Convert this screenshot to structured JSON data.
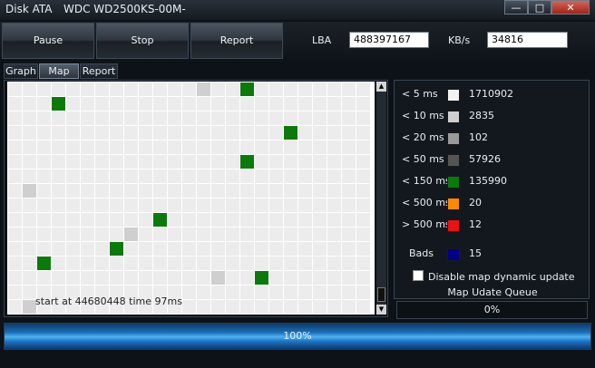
{
  "window": {
    "title": "Disk ATA",
    "model": "WDC WD2500KS-00M-",
    "controls": [
      "—",
      "□",
      "✕"
    ]
  },
  "toolbar": {
    "pause_label": "Pause",
    "stop_label": "Stop",
    "report_label": "Report",
    "lba_label": "LBA",
    "lba_value": "488397167",
    "speed_label": "KB/s",
    "speed_value": "34816"
  },
  "tabs": [
    {
      "label": "Graph"
    },
    {
      "label": "Map",
      "active": true
    },
    {
      "label": "Report"
    }
  ],
  "map": {
    "status_line": "start at 44680448 time 97ms",
    "colors": {
      "background": "#e6e6e6",
      "grid": "#ffffff",
      "gray": "#cfcfcf",
      "green": "#0a7a0a",
      "cell_base": "#ececec"
    },
    "cols": 25,
    "rows": 16,
    "blocks": [
      {
        "col": 13,
        "row": 0,
        "class": "gray"
      },
      {
        "col": 16,
        "row": 0,
        "class": "green"
      },
      {
        "col": 3,
        "row": 1,
        "class": "green"
      },
      {
        "col": 19,
        "row": 3,
        "class": "green"
      },
      {
        "col": 16,
        "row": 5,
        "class": "green"
      },
      {
        "col": 1,
        "row": 7,
        "class": "gray"
      },
      {
        "col": 10,
        "row": 9,
        "class": "green"
      },
      {
        "col": 8,
        "row": 10,
        "class": "gray"
      },
      {
        "col": 7,
        "row": 11,
        "class": "green"
      },
      {
        "col": 2,
        "row": 12,
        "class": "green"
      },
      {
        "col": 14,
        "row": 13,
        "class": "gray"
      },
      {
        "col": 17,
        "row": 13,
        "class": "green"
      },
      {
        "col": 1,
        "row": 15,
        "class": "gray"
      }
    ]
  },
  "legend": {
    "items": [
      {
        "label": "< 5 ms",
        "color": "#f2f2f2",
        "count": "1710902"
      },
      {
        "label": "< 10 ms",
        "color": "#cfcfcf",
        "count": "2835"
      },
      {
        "label": "< 20 ms",
        "color": "#9a9a9a",
        "count": "102"
      },
      {
        "label": "< 50 ms",
        "color": "#555555",
        "count": "57926"
      },
      {
        "label": "< 150 ms",
        "color": "#0a7a0a",
        "count": "135990"
      },
      {
        "label": "< 500 ms",
        "color": "#ff8a00",
        "count": "20"
      },
      {
        "label": "> 500 ms",
        "color": "#ee1111",
        "count": "12"
      }
    ],
    "bads": {
      "label": "Bads",
      "color": "#00008a",
      "count": "15"
    },
    "checkbox_label": "Disable map dynamic update",
    "queue_label": "Map Udate Queue",
    "queue_value": "0%"
  },
  "progress": {
    "value": 1.0,
    "label": "100%"
  }
}
